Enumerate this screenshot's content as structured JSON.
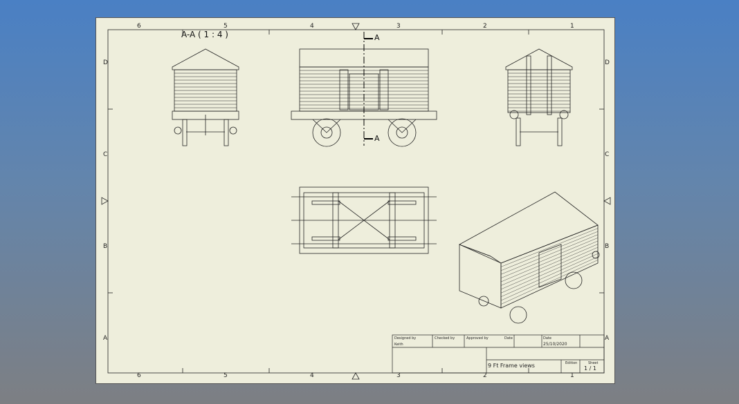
{
  "zones": {
    "columns": [
      "6",
      "5",
      "4",
      "3",
      "2",
      "1"
    ],
    "rows": [
      "D",
      "C",
      "B",
      "A"
    ]
  },
  "views": {
    "section_title": "A-A ( 1 : 4 )",
    "section_marker": "A"
  },
  "title_block": {
    "designed_by_label": "Designed by",
    "designed_by": "Keith",
    "checked_by_label": "Checked by",
    "approved_by_label": "Approved by",
    "date_label_1": "Date",
    "date_label_2": "Date",
    "date": "25/10/2020",
    "title": "9 Ft Frame views",
    "edition_label": "Edition",
    "sheet_label": "Sheet",
    "sheet": "1 / 1"
  }
}
